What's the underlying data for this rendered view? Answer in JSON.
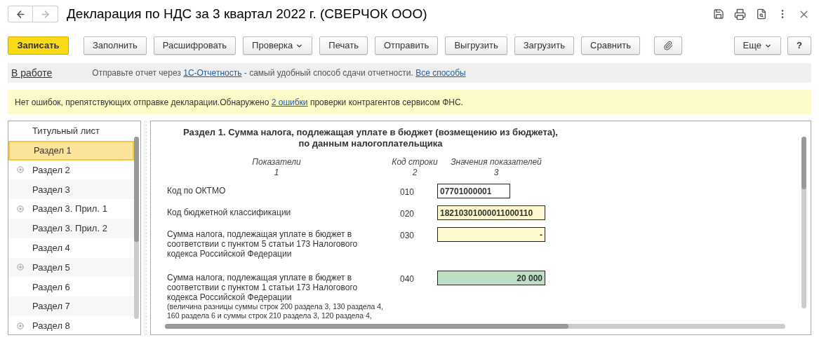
{
  "window": {
    "title": "Декларация по НДС за 3 квартал 2022 г. (СВЕРЧОК ООО)"
  },
  "toolbar": {
    "primary": "Записать",
    "buttons": [
      {
        "label": "Заполнить",
        "dropdown": false
      },
      {
        "label": "Расшифровать",
        "dropdown": false
      },
      {
        "label": "Проверка",
        "dropdown": true
      },
      {
        "label": "Печать",
        "dropdown": false
      },
      {
        "label": "Отправить",
        "dropdown": false
      },
      {
        "label": "Выгрузить",
        "dropdown": false
      },
      {
        "label": "Загрузить",
        "dropdown": false
      },
      {
        "label": "Сравнить",
        "dropdown": false
      }
    ],
    "more": "Еще",
    "help": "?"
  },
  "status_bar": {
    "status": "В работе",
    "text_before": "Отправьте отчет через",
    "link": "1С-Отчетность",
    "text_after": "- самый удобный способ сдачи отчетности.",
    "all_link": "Все способы"
  },
  "notice": {
    "text_before": "Нет ошибок, препятствующих отправке декларации.Обнаружено",
    "link": "2 ошибки",
    "text_after": "проверки контрагентов сервисом ФНС."
  },
  "sections": [
    {
      "label": "Титульный лист",
      "expandable": false,
      "selected": false
    },
    {
      "label": "Раздел 1",
      "expandable": false,
      "selected": true
    },
    {
      "label": "Раздел 2",
      "expandable": true,
      "selected": false
    },
    {
      "label": "Раздел 3",
      "expandable": false,
      "selected": false
    },
    {
      "label": "Раздел 3. Прил. 1",
      "expandable": true,
      "selected": false
    },
    {
      "label": "Раздел 3. Прил. 2",
      "expandable": false,
      "selected": false
    },
    {
      "label": "Раздел 4",
      "expandable": false,
      "selected": false
    },
    {
      "label": "Раздел 5",
      "expandable": true,
      "selected": false
    },
    {
      "label": "Раздел 6",
      "expandable": false,
      "selected": false
    },
    {
      "label": "Раздел 7",
      "expandable": false,
      "selected": false
    },
    {
      "label": "Раздел 8",
      "expandable": true,
      "selected": false
    }
  ],
  "form": {
    "title_line_1": "Раздел 1. Сумма налога, подлежащая уплате в бюджет (возмещению из бюджета),",
    "title_line_2": "по данным налогоплательщика",
    "columns": [
      {
        "name": "Показатели",
        "number": "1"
      },
      {
        "name": "Код строки",
        "number": "2"
      },
      {
        "name": "Значения показателей",
        "number": "3"
      }
    ],
    "rows": [
      {
        "label": "Код по ОКТМО",
        "code": "010",
        "value": "07701000001",
        "kind": "plain"
      },
      {
        "label": "Код бюджетной классификации",
        "code": "020",
        "value": "18210301000011000110",
        "kind": "input"
      },
      {
        "label": "Сумма налога, подлежащая уплате в бюджет в соответствии с пунктом 5 статьи 173 Налогового кодекса Российской Федерации",
        "code": "030",
        "value": "-",
        "kind": "input"
      },
      {
        "label": "Сумма налога, подлежащая уплате в бюджет в соответствии с пунктом 1 статьи 173 Налогового кодекса Российской Федерации",
        "note_lines": [
          "(величина разницы суммы строк 200 раздела 3, 130 раздела 4,",
          "160 раздела 6 и суммы строк 210 раздела 3, 120 раздела 4,"
        ],
        "code": "040",
        "value": "20 000",
        "kind": "calculated"
      }
    ]
  }
}
